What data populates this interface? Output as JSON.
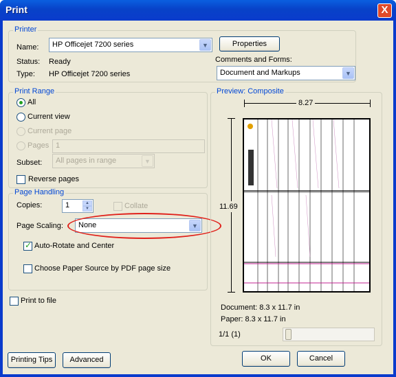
{
  "window": {
    "title": "Print",
    "close_glyph": "X"
  },
  "printer": {
    "group_label": "Printer",
    "name_label": "Name:",
    "name_value": "HP Officejet 7200 series",
    "status_label": "Status:",
    "status_value": "Ready",
    "type_label": "Type:",
    "type_value": "HP Officejet 7200 series",
    "properties_button": "Properties",
    "comments_label": "Comments and Forms:",
    "comments_value": "Document and Markups"
  },
  "print_range": {
    "group_label": "Print Range",
    "all": "All",
    "current_view": "Current view",
    "current_page": "Current page",
    "pages": "Pages",
    "pages_value": "1",
    "subset_label": "Subset:",
    "subset_value": "All pages in range",
    "reverse_pages": "Reverse pages"
  },
  "page_handling": {
    "group_label": "Page Handling",
    "copies_label": "Copies:",
    "copies_value": "1",
    "collate": "Collate",
    "page_scaling_label": "Page Scaling:",
    "page_scaling_value": "None",
    "auto_rotate": "Auto-Rotate and Center",
    "choose_paper_source": "Choose Paper Source by PDF page size",
    "highlight_color": "#e0201a"
  },
  "print_to_file": "Print to file",
  "preview": {
    "group_label": "Preview: Composite",
    "width": "8.27",
    "height": "11.69",
    "document_size": "Document: 8.3 x 11.7 in",
    "paper_size": "Paper: 8.3 x 11.7 in",
    "page_counter": "1/1 (1)"
  },
  "buttons": {
    "printing_tips": "Printing Tips",
    "advanced": "Advanced",
    "ok": "OK",
    "cancel": "Cancel"
  }
}
